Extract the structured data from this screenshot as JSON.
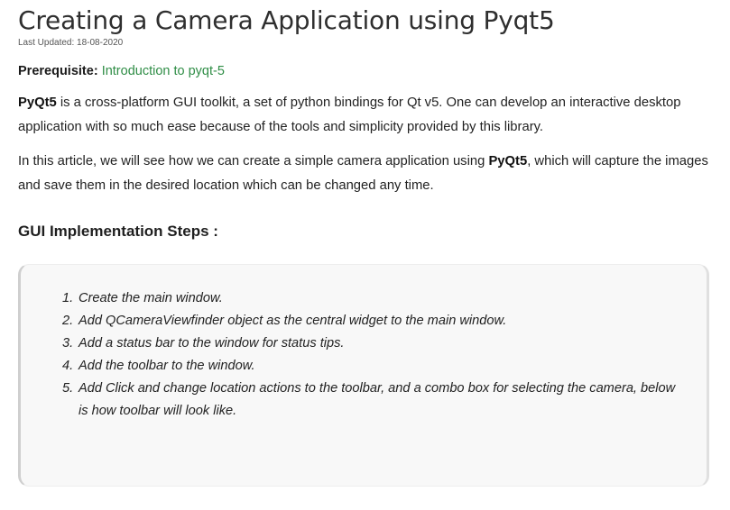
{
  "article": {
    "title": "Creating a Camera Application using Pyqt5",
    "last_updated": "Last Updated: 18-08-2020",
    "prerequisite_label": "Prerequisite:",
    "prerequisite_link": "Introduction to pyqt-5",
    "paragraph1": {
      "bold": "PyQt5",
      "rest": " is a cross-platform GUI toolkit, a set of python bindings for Qt v5. One can develop an interactive desktop application with so much ease because of the tools and simplicity provided by this library."
    },
    "paragraph2": {
      "before": "In this article, we will see how we can create a simple camera application using ",
      "bold": "PyQt5",
      "after": ", which will capture the images and save them in the desired location which can be changed any time."
    },
    "section_heading": "GUI Implementation Steps :",
    "steps": [
      {
        "num": "1.",
        "text": "Create the main window."
      },
      {
        "num": "2.",
        "text": "Add QCameraViewfinder object as the central widget to the main window."
      },
      {
        "num": "3.",
        "text": "Add a status bar to the window for status tips."
      },
      {
        "num": "4.",
        "text": "Add the toolbar to the window."
      },
      {
        "num": "5.",
        "text": "Add Click and change location actions to the toolbar, and a combo box for selecting the camera, below is how toolbar will look like."
      }
    ]
  },
  "colors": {
    "link": "#2f8d46",
    "steps_background": "#f8f8f8",
    "steps_border": "#cfcfcf",
    "text": "#222222"
  }
}
